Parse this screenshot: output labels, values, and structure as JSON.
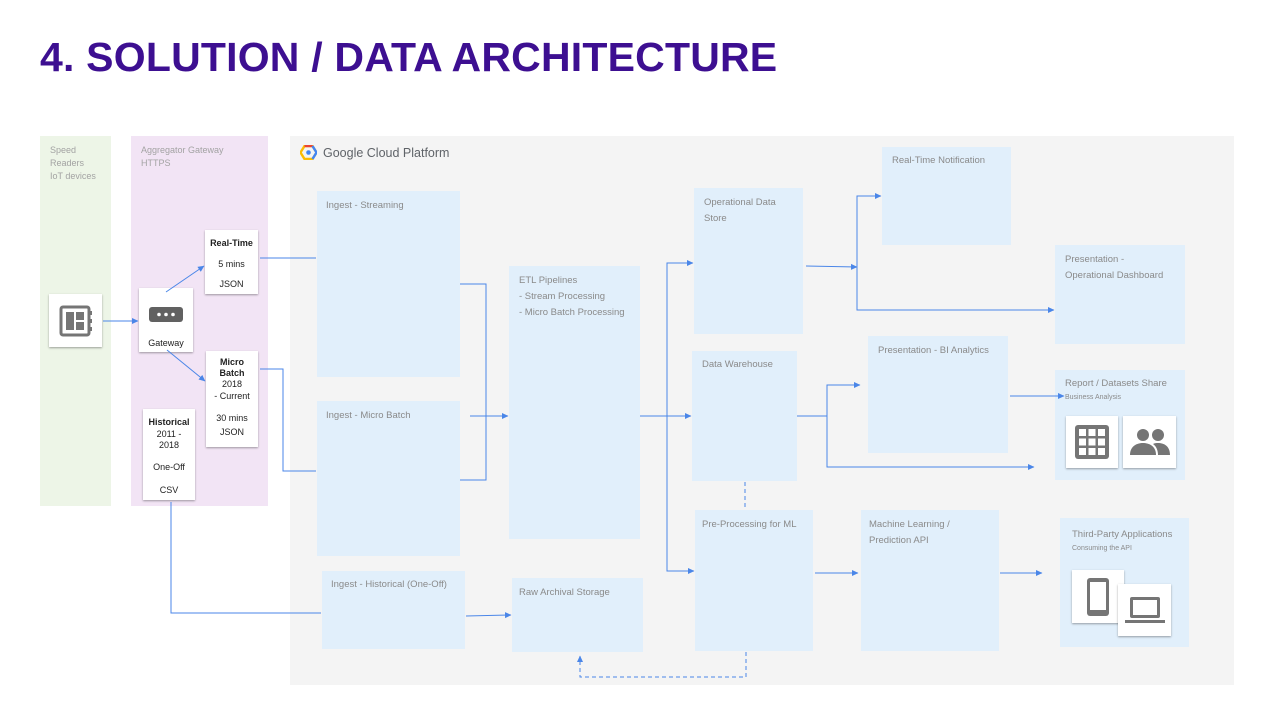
{
  "title": "4. SOLUTION / DATA ARCHITECTURE",
  "sources": {
    "speed_readers_lines": [
      "Speed",
      "Readers",
      "IoT devices"
    ],
    "aggregator_lines": [
      "Aggregator Gateway",
      "HTTPS"
    ],
    "gateway_label": "Gateway",
    "realtime": {
      "title": "Real-Time",
      "interval": "5 mins",
      "format": "JSON"
    },
    "microbatch": {
      "title_line1": "Micro",
      "title_line2": "Batch",
      "years": "2018",
      "range": "- Current",
      "interval": "30 mins",
      "format": "JSON"
    },
    "historical": {
      "title": "Historical",
      "years_line1": "2011 -",
      "years_line2": "2018",
      "mode": "One-Off",
      "format": "CSV"
    }
  },
  "gcp": {
    "logo_text": "Google Cloud Platform"
  },
  "boxes": {
    "ingest_streaming": "Ingest - Streaming",
    "ingest_microbatch": "Ingest - Micro Batch",
    "ingest_historical": "Ingest - Historical  (One-Off)",
    "etl_lines": [
      "ETL Pipelines",
      "- Stream Processing",
      "- Micro Batch Processing"
    ],
    "raw_archival": "Raw Archival Storage",
    "ods_lines": [
      "Operational Data",
      "Store"
    ],
    "data_warehouse": "Data Warehouse",
    "preprocessing_ml": "Pre-Processing for ML",
    "realtime_notification": "Real-Time Notification",
    "presentation_bi": "Presentation - BI Analytics",
    "ml_lines": [
      "Machine Learning /",
      "Prediction  API"
    ],
    "presentation_ops_lines": [
      "Presentation -",
      "Operational Dashboard"
    ],
    "report_share": {
      "title": "Report / Datasets Share",
      "subtitle": "Business Analysis"
    },
    "third_party": {
      "title": "Third-Party Applications",
      "subtitle": "Consuming the API"
    }
  },
  "colors": {
    "title": "#3d0f91",
    "arrow": "#4a86e8",
    "box_fill": "#e1effb",
    "gcp_background": "#f4f4f4",
    "speed_band": "#edf5e7",
    "aggregator_band": "#f2e4f5",
    "icon_gray": "#757575"
  },
  "icons": [
    "device-board-icon",
    "gateway-icon",
    "table-grid-icon",
    "people-icon",
    "smartphone-icon",
    "laptop-icon",
    "google-cloud-icon"
  ]
}
